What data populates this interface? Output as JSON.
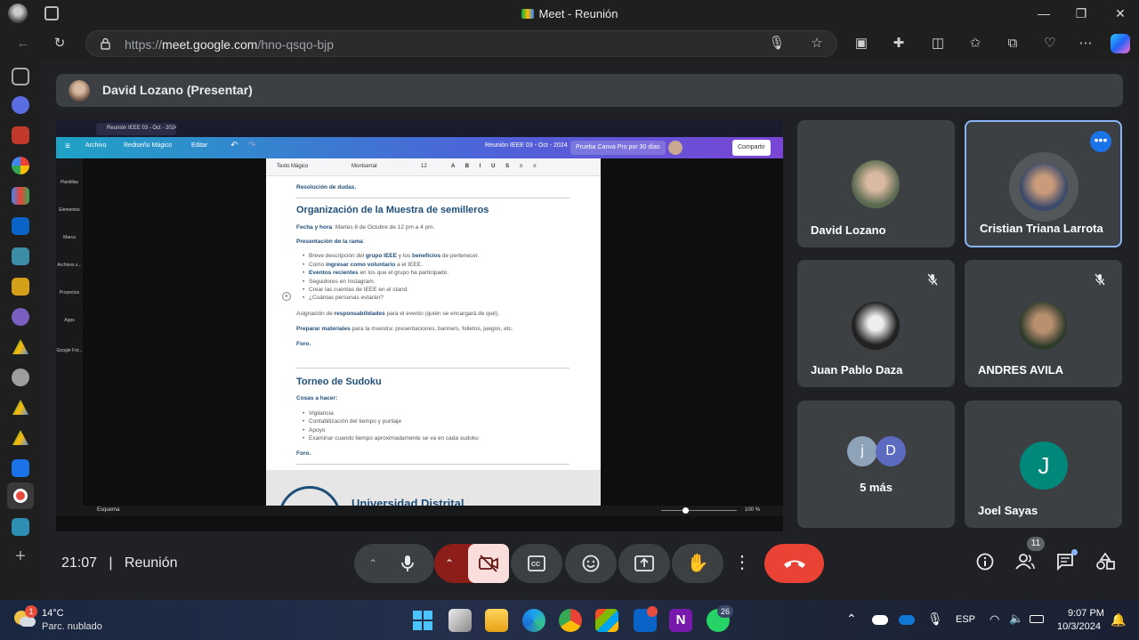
{
  "window": {
    "title": "Meet - Reunión"
  },
  "browser": {
    "url_prefix": "https://",
    "url_host": "meet.google.com",
    "url_path": "/hno-qsqo-bjp"
  },
  "meet": {
    "presenter_label": "David Lozano (Presentar)",
    "time": "21:07",
    "separator": "|",
    "meeting_title": "Reunión",
    "participants_count": "11",
    "tiles": [
      {
        "name": "David Lozano"
      },
      {
        "name": "Cristian Triana Larrota"
      },
      {
        "name": "Juan Pablo Daza"
      },
      {
        "name": "ANDRES AVILA"
      },
      {
        "name": "5 más",
        "initials": [
          "j",
          "D"
        ]
      },
      {
        "name": "Joel Sayas",
        "initial": "J"
      }
    ]
  },
  "canva": {
    "menu": [
      "Archivo",
      "Rediseño Mágico",
      "Editar"
    ],
    "doc_title": "Reunión IEEE 03 - Oct - 2024",
    "promo": "Prueba Canva Pro por 30 días",
    "share": "Compartir",
    "side": [
      "Plantillas",
      "Elementos",
      "Marca",
      "Archivos s...",
      "Proyectos",
      "Apps",
      "Google Fot..."
    ],
    "toolbar": {
      "magic": "Texto Mágico",
      "font": "Montserrat",
      "size": "12"
    },
    "doc": {
      "line1": "Resolución de dudas.",
      "h1": "Organización de la Muestra de semilleros",
      "date_label": "Fecha y hora",
      "date_value": ": Martes 8 de Octubre de 12 pm a 4 pm.",
      "pres_label": "Presentación de la rama",
      "bullets": [
        [
          "Breve descripción del ",
          "grupo IEEE",
          " y los ",
          "beneficios",
          " de pertenecer."
        ],
        [
          "Como ",
          "ingresar como voluntario",
          " a el IEEE."
        ],
        [
          "",
          "Eventos recientes",
          " en los que el grupo ha participado."
        ],
        [
          "Seguidores en Instagram."
        ],
        [
          "Crear las cuentas de IEEE en el stand."
        ],
        [
          "¿Cuántas personas estarán?"
        ]
      ],
      "asig_pre": "Asignación de ",
      "asig_b": "responsabilidades",
      "asig_post": " para el evento (quién se encargará de qué).",
      "prep_b": "Preparar materiales",
      "prep_post": " para la muestra: presentaciones, banners, folletos, juegos, etc.",
      "foro": "Foro.",
      "h2": "Torneo de Sudoku",
      "cosas": "Cosas a hacer:",
      "bullets2": [
        "Vigilancia",
        "Contabilización del tiempo y puntaje",
        "Apoyo",
        "Examinar cuando tiempo aproximadamente se va en cada sudoku"
      ],
      "foro2": "Foro.",
      "banner_text": "Universidad Distrital"
    },
    "footer_left": "Esquema",
    "zoom": "100 %"
  },
  "taskbar": {
    "weather_temp": "14°C",
    "weather_desc": "Parc. nublado",
    "weather_badge": "1",
    "lang": "ESP",
    "time": "9:07 PM",
    "date": "10/3/2024",
    "whatsapp_badge": "26"
  },
  "colors": {
    "end_call": "#ea4335",
    "camera_off": "#f9dedc",
    "accent_blue": "#8ab4f8"
  }
}
